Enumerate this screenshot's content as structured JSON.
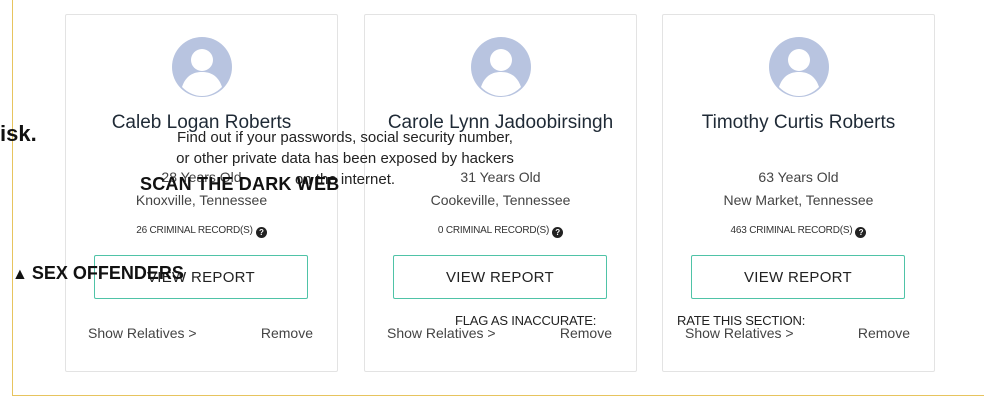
{
  "cards": [
    {
      "name": "Caleb Logan Roberts",
      "age": "28 Years Old",
      "location": "Knoxville, Tennessee",
      "records": "26 CRIMINAL RECORD(S)",
      "button": "VIEW REPORT",
      "relatives": "Show Relatives >",
      "remove": "Remove"
    },
    {
      "name": "Carole Lynn Jadoobirsingh",
      "age": "31 Years Old",
      "location": "Cookeville, Tennessee",
      "records": "0 CRIMINAL RECORD(S)",
      "button": "VIEW REPORT",
      "relatives": "Show Relatives >",
      "remove": "Remove"
    },
    {
      "name": "Timothy Curtis Roberts",
      "age": "63 Years Old",
      "location": "New Market, Tennessee",
      "records": "463 CRIMINAL RECORD(S)",
      "button": "VIEW REPORT",
      "relatives": "Show Relatives >",
      "remove": "Remove"
    }
  ],
  "overlay": {
    "risk_fragment": "isk.",
    "find_out": "Find out if your passwords, social security number, or other private data has been exposed by hackers on the internet.",
    "scan_dark_web": "SCAN THE DARK WEB",
    "sex_offenders": "SEX OFFENDERS",
    "flag_inaccurate": "FLAG AS INACCURATE:",
    "rate_section": "RATE THIS SECTION:"
  },
  "colors": {
    "accent_border": "#4fc3a7",
    "frame_border": "#e7c45e",
    "avatar": "#b8c4e0"
  },
  "icons": {
    "avatar": "user-avatar-icon",
    "info": "question-circle-icon",
    "warning": "warning-triangle-icon"
  }
}
